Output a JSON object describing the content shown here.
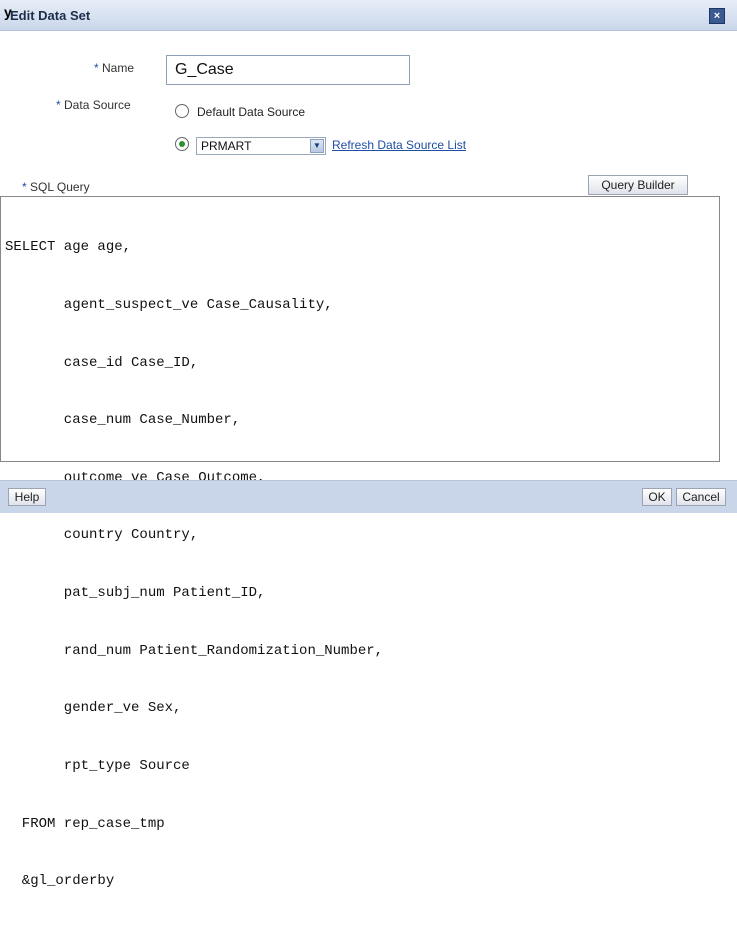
{
  "window": {
    "cursor_symbol": "y",
    "title": "Edit Data Set",
    "close_icon": "close-icon"
  },
  "form": {
    "name_label": "Name",
    "name_value": "G_Case",
    "data_source_label": "Data Source",
    "radio_default_label": "Default Data Source",
    "selected_source": "PRMART",
    "refresh_link": "Refresh Data Source List",
    "sql_label": "SQL Query",
    "query_builder_button": "Query Builder",
    "sql_lines": [
      "SELECT age age,",
      "       agent_suspect_ve Case_Causality,",
      "       case_id Case_ID,",
      "       case_num Case_Number,",
      "       outcome_ve Case_Outcome,",
      "       country Country,",
      "       pat_subj_num Patient_ID,",
      "       rand_num Patient_Randomization_Number,",
      "       gender_ve Sex,",
      "       rpt_type Source",
      "  FROM rep_case_tmp",
      "  &gl_orderby"
    ]
  },
  "footer": {
    "help_button": "Help",
    "ok_button": "OK",
    "cancel_button": "Cancel"
  },
  "colors": {
    "title_bar": "#c9d6ea",
    "link": "#1f4ea3",
    "radio_selected": "#2f8f2f"
  }
}
